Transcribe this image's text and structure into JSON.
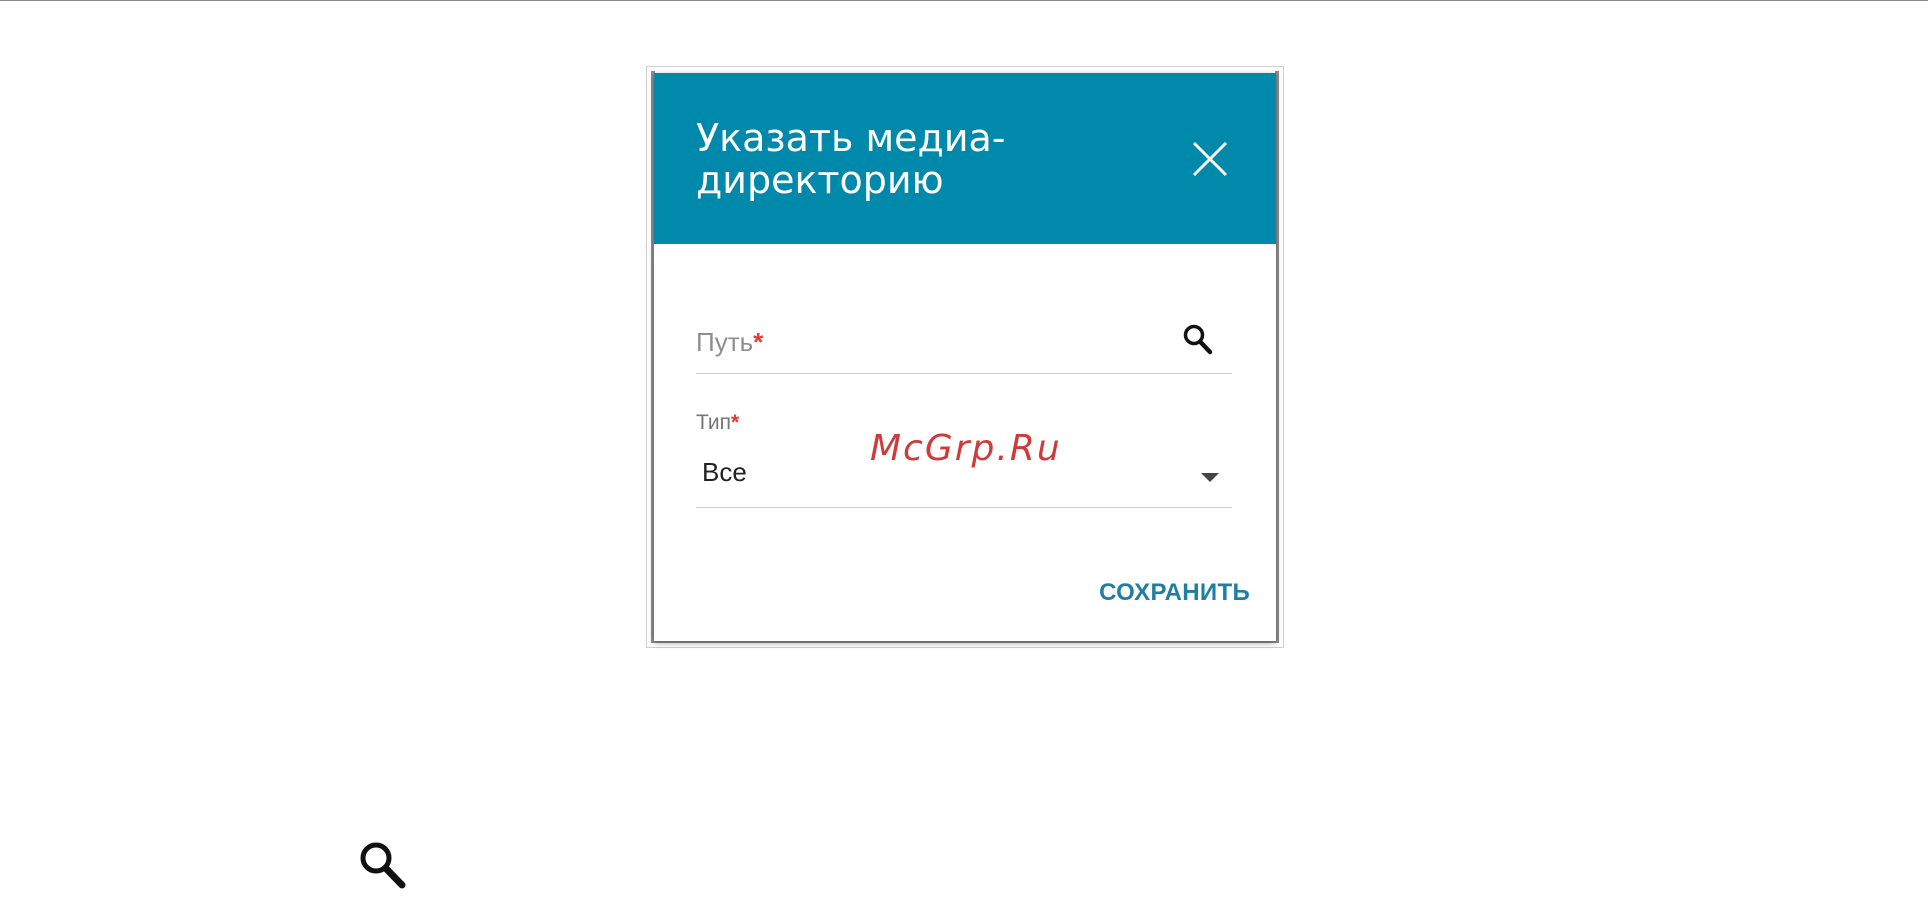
{
  "dialog": {
    "title": "Указать медиа-директорию",
    "close_icon": "close-icon",
    "header_color": "#0089ab",
    "path_field": {
      "placeholder": "Путь",
      "required_mark": "*",
      "icon": "search-icon"
    },
    "type_field": {
      "label": "Тип",
      "required_mark": "*",
      "value": "Все",
      "icon": "dropdown-arrow-icon"
    },
    "save_label": "СОХРАНИТЬ",
    "save_color": "#1f7ea1"
  },
  "watermark": {
    "text": "McGrp.Ru",
    "color": "#cc2b2b"
  },
  "legend_icon": "search-icon"
}
